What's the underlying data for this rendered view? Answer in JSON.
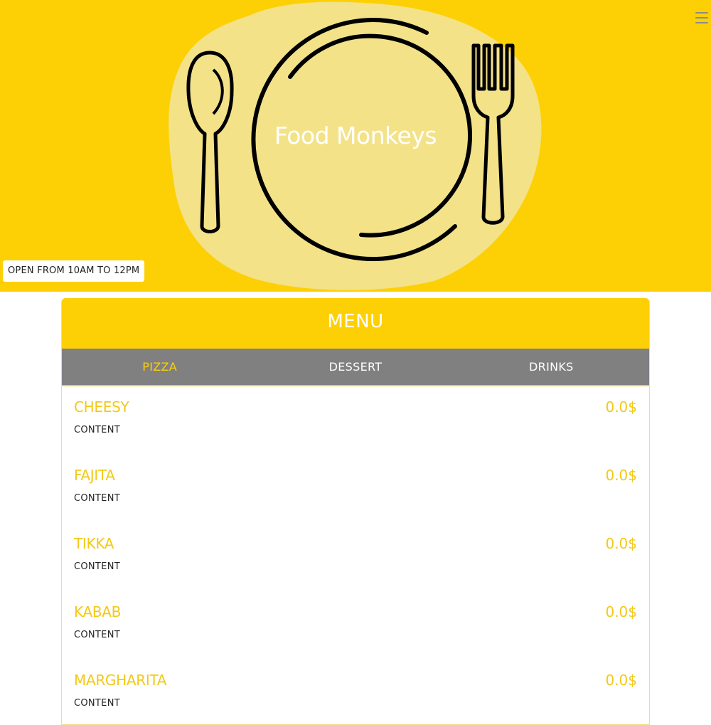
{
  "header": {
    "brand": "Food Monkeys",
    "hours": "OPEN FROM 10AM TO 12PM",
    "menu_icon": "hamburger-menu-icon"
  },
  "menu": {
    "title": "MENU",
    "tabs": [
      {
        "label": "PIZZA",
        "active": true
      },
      {
        "label": "DESSERT",
        "active": false
      },
      {
        "label": "DRINKS",
        "active": false
      }
    ],
    "items": [
      {
        "name": "CHEESY",
        "price": "0.0$",
        "description": "CONTENT"
      },
      {
        "name": "FAJITA",
        "price": "0.0$",
        "description": "CONTENT"
      },
      {
        "name": "TIKKA",
        "price": "0.0$",
        "description": "CONTENT"
      },
      {
        "name": "KABAB",
        "price": "0.0$",
        "description": "CONTENT"
      },
      {
        "name": "MARGHARITA",
        "price": "0.0$",
        "description": "CONTENT"
      }
    ]
  },
  "colors": {
    "accent": "#fdd006",
    "tab_bar": "#808080",
    "item_title": "#f2c919"
  }
}
